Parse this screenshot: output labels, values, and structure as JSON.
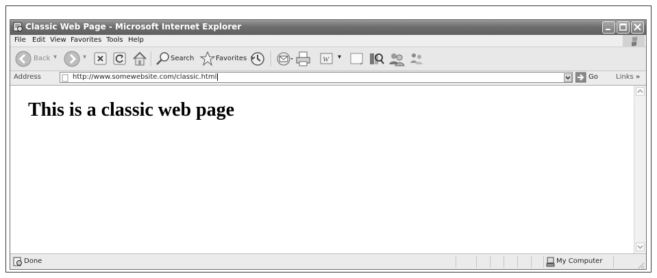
{
  "window": {
    "title": "Classic Web Page - Microsoft Internet Explorer",
    "controls": [
      "minimize-icon",
      "maximize-icon",
      "close-icon"
    ]
  },
  "menu": {
    "items": [
      "File",
      "Edit",
      "View",
      "Favorites",
      "Tools",
      "Help"
    ]
  },
  "toolbar": {
    "back_label": "Back",
    "search_label": "Search",
    "favorites_label": "Favorites",
    "icons": [
      "back-icon",
      "forward-icon",
      "stop-icon",
      "refresh-icon",
      "home-icon",
      "search-icon",
      "favorites-star-icon",
      "history-icon",
      "mail-icon",
      "print-icon",
      "word-edit-icon",
      "discuss-icon",
      "research-icon",
      "messenger-icon",
      "contacts-icon"
    ]
  },
  "address_bar": {
    "label": "Address",
    "url": "http://www.somewebsite.com/classic.html",
    "go_label": "Go",
    "links_label": "Links"
  },
  "page": {
    "heading": "This is a classic web page"
  },
  "status_bar": {
    "status": "Done",
    "zone": "My Computer"
  }
}
